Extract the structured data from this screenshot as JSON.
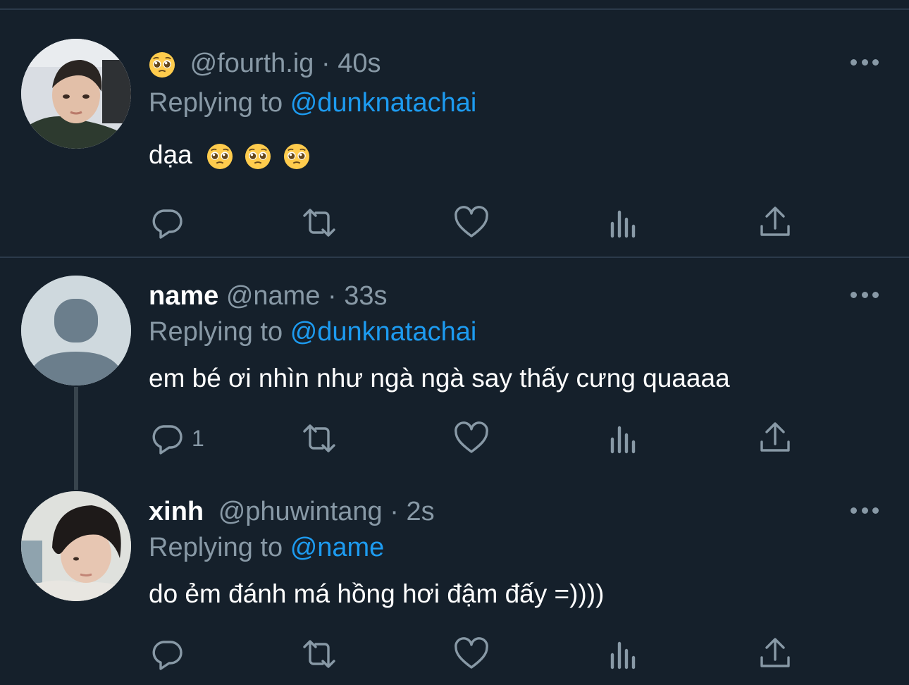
{
  "tweets": [
    {
      "display_name": "",
      "handle": "@fourth.ig",
      "time": "40s",
      "replying_label": "Replying to",
      "replying_to": "@dunknatachai",
      "text": "dạa",
      "reply_count": ""
    },
    {
      "display_name": "name",
      "handle": "@name",
      "time": "33s",
      "replying_label": "Replying to",
      "replying_to": "@dunknatachai",
      "text": "em bé ơi nhìn như ngà ngà say thấy cưng quaaaa",
      "reply_count": "1"
    },
    {
      "display_name": "xinh",
      "handle": "@phuwintang",
      "time": "2s",
      "replying_label": "Replying to",
      "replying_to": "@name",
      "text": "do ẻm đánh má hồng hơi đậm đấy =))))",
      "reply_count": ""
    }
  ],
  "separator": "·",
  "icons": [
    "pleading-face-emoji",
    "more-icon",
    "reply-icon",
    "retweet-icon",
    "like-icon",
    "analytics-icon",
    "share-icon",
    "default-avatar-icon"
  ],
  "colors": {
    "background": "#15202b",
    "muted": "#8899a6",
    "mention": "#1d9bf0",
    "text": "#ffffff"
  }
}
